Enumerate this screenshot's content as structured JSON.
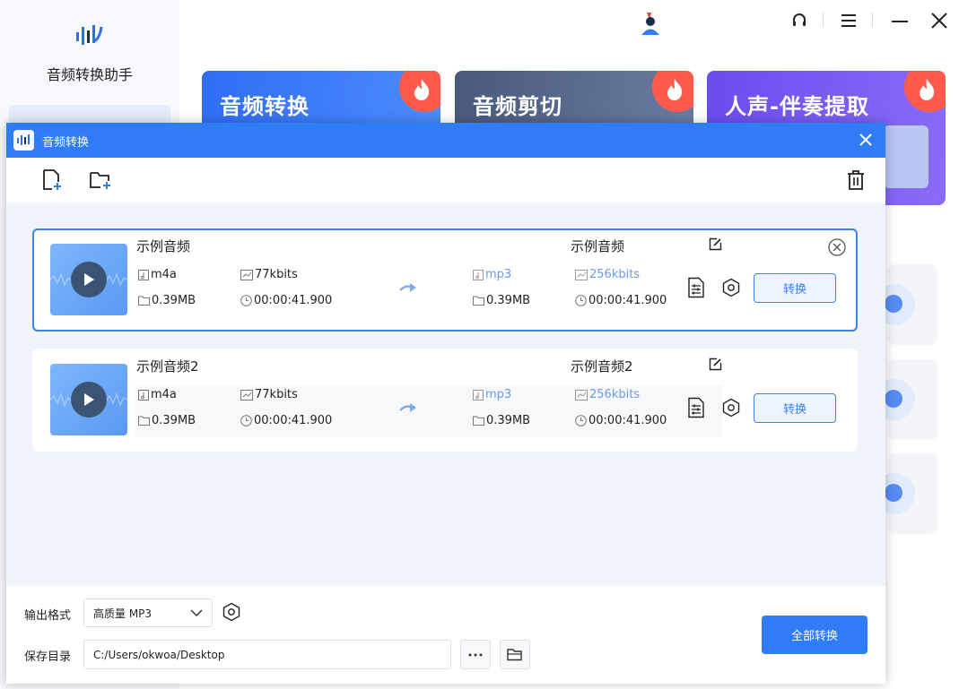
{
  "app": {
    "name": "音频转换助手"
  },
  "background": {
    "cards": [
      {
        "title": "音频转换"
      },
      {
        "title": "音频剪切"
      },
      {
        "title": "人声-伴奏提取"
      }
    ]
  },
  "dialog": {
    "title": "音频转换",
    "files": [
      {
        "name": "示例音频",
        "format": "m4a",
        "bitrate": "77kbits",
        "size": "0.39MB",
        "duration": "00:00:41.900",
        "output_name": "示例音频",
        "output_format": "mp3",
        "output_bitrate": "256kbits",
        "output_size": "0.39MB",
        "output_duration": "00:00:41.900",
        "convert_label": "转换"
      },
      {
        "name": "示例音频2",
        "format": "m4a",
        "bitrate": "77kbits",
        "size": "0.39MB",
        "duration": "00:00:41.900",
        "output_name": "示例音频2",
        "output_format": "mp3",
        "output_bitrate": "256kbits",
        "output_size": "0.39MB",
        "output_duration": "00:00:41.900",
        "convert_label": "转换"
      }
    ],
    "bottom": {
      "output_format_label": "输出格式",
      "output_format_value": "高质量 MP3",
      "save_dir_label": "保存目录",
      "save_dir_value": "C:/Users/okwoa/Desktop",
      "convert_all_label": "全部转换"
    }
  },
  "colors": {
    "accent": "#2f7cf6",
    "output_meta": "#6a9ae8"
  }
}
